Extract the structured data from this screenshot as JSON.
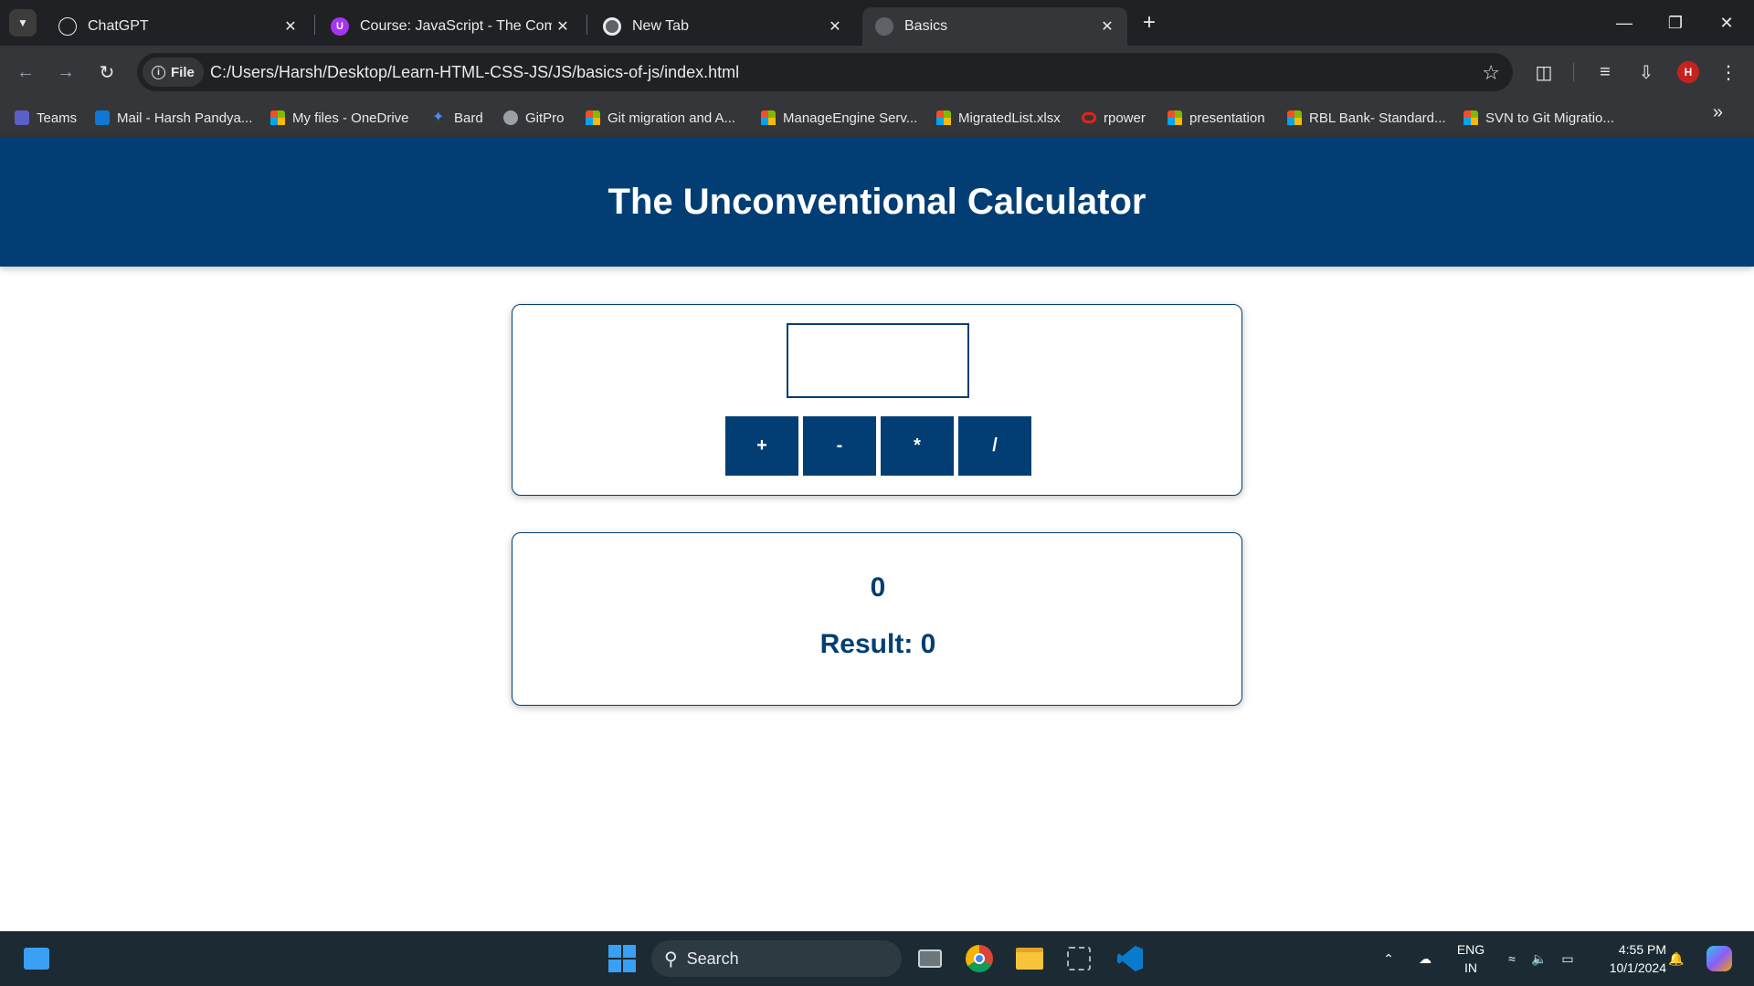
{
  "browser": {
    "tabs": [
      {
        "title": "ChatGPT",
        "icon": "chatgpt-icon"
      },
      {
        "title": "Course: JavaScript - The Compl",
        "icon": "udemy-icon"
      },
      {
        "title": "New Tab",
        "icon": "chrome-icon"
      },
      {
        "title": "Basics",
        "icon": "globe-icon",
        "active": true
      }
    ],
    "address": {
      "chip_label": "File",
      "url": "C:/Users/Harsh/Desktop/Learn-HTML-CSS-JS/JS/basics-of-js/index.html"
    },
    "profile_initial": "H",
    "bookmarks": [
      {
        "label": "Teams",
        "icon": "teams-icon"
      },
      {
        "label": "Mail - Harsh Pandya...",
        "icon": "outlook-icon"
      },
      {
        "label": "My files - OneDrive",
        "icon": "microsoft-icon"
      },
      {
        "label": "Bard",
        "icon": "bard-icon"
      },
      {
        "label": "GitPro",
        "icon": "globe-icon"
      },
      {
        "label": "Git migration and A...",
        "icon": "microsoft-icon"
      },
      {
        "label": "ManageEngine Serv...",
        "icon": "microsoft-icon"
      },
      {
        "label": "MigratedList.xlsx",
        "icon": "microsoft-icon"
      },
      {
        "label": "rpower",
        "icon": "oracle-icon"
      },
      {
        "label": "presentation",
        "icon": "microsoft-icon"
      },
      {
        "label": "RBL Bank- Standard...",
        "icon": "microsoft-icon"
      },
      {
        "label": "SVN to Git Migratio...",
        "icon": "microsoft-icon"
      }
    ]
  },
  "app": {
    "title": "The Unconventional Calculator",
    "input_value": "",
    "operators": [
      "+",
      "-",
      "*",
      "/"
    ],
    "calc_description": "0",
    "result_text": "Result: 0",
    "accent_color": "#023e73"
  },
  "taskbar": {
    "search_placeholder": "Search",
    "language": "ENG",
    "region": "IN",
    "time": "4:55 PM",
    "date": "10/1/2024"
  }
}
